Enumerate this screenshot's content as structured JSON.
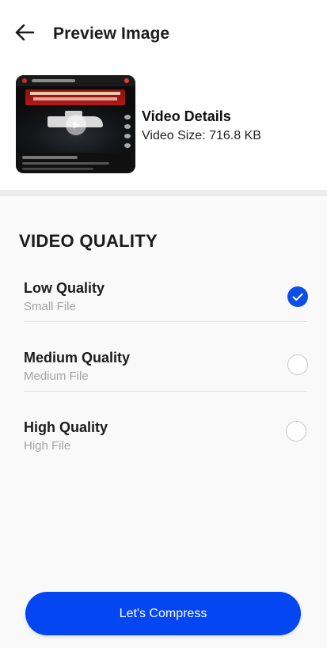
{
  "header": {
    "title": "Preview Image",
    "back_icon": "arrow-left-icon"
  },
  "preview": {
    "details_title": "Video Details",
    "size_text": "Video Size: 716.8 KB",
    "play_icon": "play-icon"
  },
  "quality": {
    "section_title": "VIDEO QUALITY",
    "options": [
      {
        "label": "Low Quality",
        "sublabel": "Small File",
        "selected": true
      },
      {
        "label": "Medium Quality",
        "sublabel": "Medium File",
        "selected": false
      },
      {
        "label": "High Quality",
        "sublabel": "High File",
        "selected": false
      }
    ],
    "selected_color": "#0d4fe6"
  },
  "action": {
    "compress_label": "Let's Compress",
    "button_color": "#0546f3"
  }
}
